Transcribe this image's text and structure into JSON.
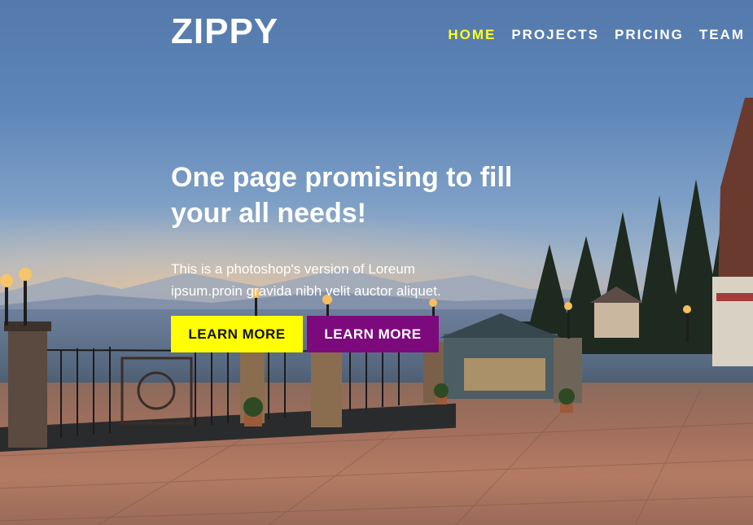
{
  "header": {
    "brand": "ZIPPY",
    "nav": [
      {
        "label": "HOME",
        "active": true
      },
      {
        "label": "PROJECTS",
        "active": false
      },
      {
        "label": "PRICING",
        "active": false
      },
      {
        "label": "TEAM",
        "active": false
      }
    ]
  },
  "hero": {
    "headline": "One page promising to fill your all needs!",
    "subtext": "This is a photoshop's version of Loreum ipsum.proin gravida nibh velit auctor aliquet.",
    "buttons": [
      {
        "label": "LEARN MORE",
        "color": "#ffff00"
      },
      {
        "label": "LEARN MORE",
        "color": "#7d0a7d"
      }
    ]
  },
  "colors": {
    "nav_active": "#ffff1c",
    "nav_default": "#ffffff"
  }
}
